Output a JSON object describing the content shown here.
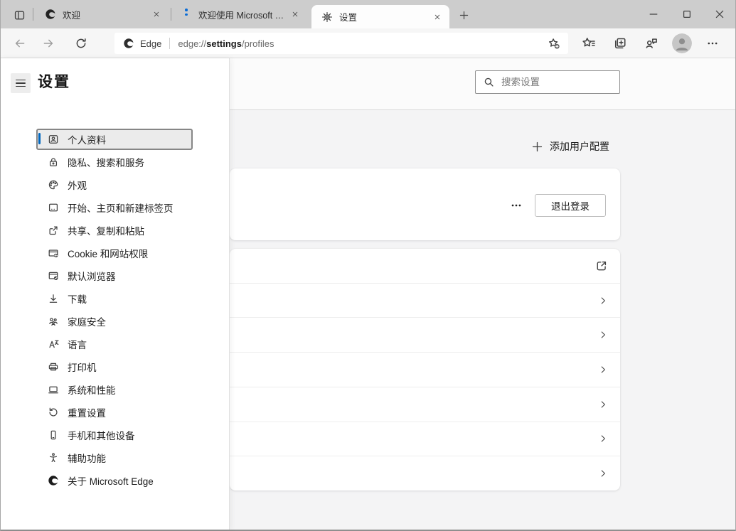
{
  "tabs": [
    {
      "title": "欢迎"
    },
    {
      "title": "欢迎使用 Microsoft Edg"
    },
    {
      "title": "设置"
    }
  ],
  "navbar": {
    "site_label": "Edge",
    "url_scheme": "edge://",
    "url_host": "settings",
    "url_path": "/profiles"
  },
  "header": {
    "title": "设置",
    "search_placeholder": "搜索设置"
  },
  "sidebar": {
    "items": [
      {
        "label": "个人资料",
        "icon": "profile-card-icon",
        "selected": true
      },
      {
        "label": "隐私、搜索和服务",
        "icon": "lock-icon"
      },
      {
        "label": "外观",
        "icon": "palette-icon"
      },
      {
        "label": "开始、主页和新建标签页",
        "icon": "start-page-icon"
      },
      {
        "label": "共享、复制和粘贴",
        "icon": "share-icon"
      },
      {
        "label": "Cookie 和网站权限",
        "icon": "cookie-permissions-icon"
      },
      {
        "label": "默认浏览器",
        "icon": "default-browser-icon"
      },
      {
        "label": "下载",
        "icon": "download-icon"
      },
      {
        "label": "家庭安全",
        "icon": "family-icon"
      },
      {
        "label": "语言",
        "icon": "language-icon"
      },
      {
        "label": "打印机",
        "icon": "printer-icon"
      },
      {
        "label": "系统和性能",
        "icon": "system-icon"
      },
      {
        "label": "重置设置",
        "icon": "reset-icon"
      },
      {
        "label": "手机和其他设备",
        "icon": "phone-icon"
      },
      {
        "label": "辅助功能",
        "icon": "accessibility-icon"
      },
      {
        "label": "关于 Microsoft Edge",
        "icon": "edge-logo-icon"
      }
    ]
  },
  "main": {
    "add_profile_label": "添加用户配置",
    "sign_out_label": "退出登录"
  },
  "colors": {
    "accent_blue": "#0067c0",
    "tab_strip_bg": "#cdcdcd",
    "content_bg": "#f4f4f5"
  }
}
